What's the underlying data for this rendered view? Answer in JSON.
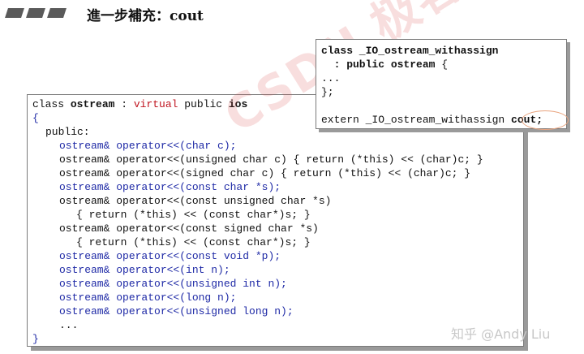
{
  "heading": "進一步補充：cout",
  "main_box": {
    "lines": [
      {
        "parts": [
          {
            "t": "class "
          },
          {
            "t": "ostream",
            "s": "b"
          },
          {
            "t": " : "
          },
          {
            "t": "virtual",
            "s": "kw-red"
          },
          {
            "t": " public "
          },
          {
            "t": "ios",
            "s": "b"
          }
        ],
        "indent": 0
      },
      {
        "parts": [
          {
            "t": "{",
            "s": "blue"
          }
        ],
        "indent": 0
      },
      {
        "parts": [
          {
            "t": "public:"
          }
        ],
        "indent": 1
      },
      {
        "parts": [
          {
            "t": "ostream& operator<<(char c);",
            "s": "blue"
          }
        ],
        "indent": 2
      },
      {
        "parts": [
          {
            "t": "ostream& operator<<(unsigned char c) { return (*this) << (char)c; }"
          }
        ],
        "indent": 2
      },
      {
        "parts": [
          {
            "t": "ostream& operator<<(signed char c) { return (*this) << (char)c; }"
          }
        ],
        "indent": 2
      },
      {
        "parts": [
          {
            "t": "ostream& operator<<(const char *s);",
            "s": "blue"
          }
        ],
        "indent": 2
      },
      {
        "parts": [
          {
            "t": "ostream& operator<<(const unsigned char *s)"
          }
        ],
        "indent": 2
      },
      {
        "parts": [
          {
            "t": "{ return (*this) << (const char*)s; }"
          }
        ],
        "indent": 3
      },
      {
        "parts": [
          {
            "t": "ostream& operator<<(const signed char *s)"
          }
        ],
        "indent": 2
      },
      {
        "parts": [
          {
            "t": "{ return (*this) << (const char*)s; }"
          }
        ],
        "indent": 3
      },
      {
        "parts": [
          {
            "t": "ostream& operator<<(const void *p);",
            "s": "blue"
          }
        ],
        "indent": 2
      },
      {
        "parts": [
          {
            "t": "ostream& operator<<(int n);",
            "s": "blue"
          }
        ],
        "indent": 2
      },
      {
        "parts": [
          {
            "t": "ostream& operator<<(unsigned int n);",
            "s": "blue"
          }
        ],
        "indent": 2
      },
      {
        "parts": [
          {
            "t": "ostream& operator<<(long n);",
            "s": "blue"
          }
        ],
        "indent": 2
      },
      {
        "parts": [
          {
            "t": "ostream& operator<<(unsigned long n);",
            "s": "blue"
          }
        ],
        "indent": 2
      },
      {
        "parts": [
          {
            "t": "..."
          }
        ],
        "indent": 2
      },
      {
        "parts": [
          {
            "t": "}",
            "s": "blue"
          }
        ],
        "indent": 0
      }
    ]
  },
  "small_box": {
    "lines": [
      {
        "parts": [
          {
            "t": "class _IO_ostream_withassign",
            "s": "b"
          }
        ],
        "indent": 0
      },
      {
        "parts": [
          {
            "t": "  : public ostream",
            "s": "b"
          },
          {
            "t": " {"
          }
        ],
        "indent": 0
      },
      {
        "parts": [
          {
            "t": "..."
          }
        ],
        "indent": 0
      },
      {
        "parts": [
          {
            "t": "};"
          }
        ],
        "indent": 0
      },
      {
        "parts": [
          {
            "t": ""
          }
        ],
        "indent": 0
      },
      {
        "parts": [
          {
            "t": "extern _IO_ostream_withassign "
          },
          {
            "t": "cout;",
            "s": "b"
          }
        ],
        "indent": 0
      }
    ]
  },
  "watermark": "CSDN 极客班",
  "zhihu_credit": "知乎 @Andy Liu"
}
